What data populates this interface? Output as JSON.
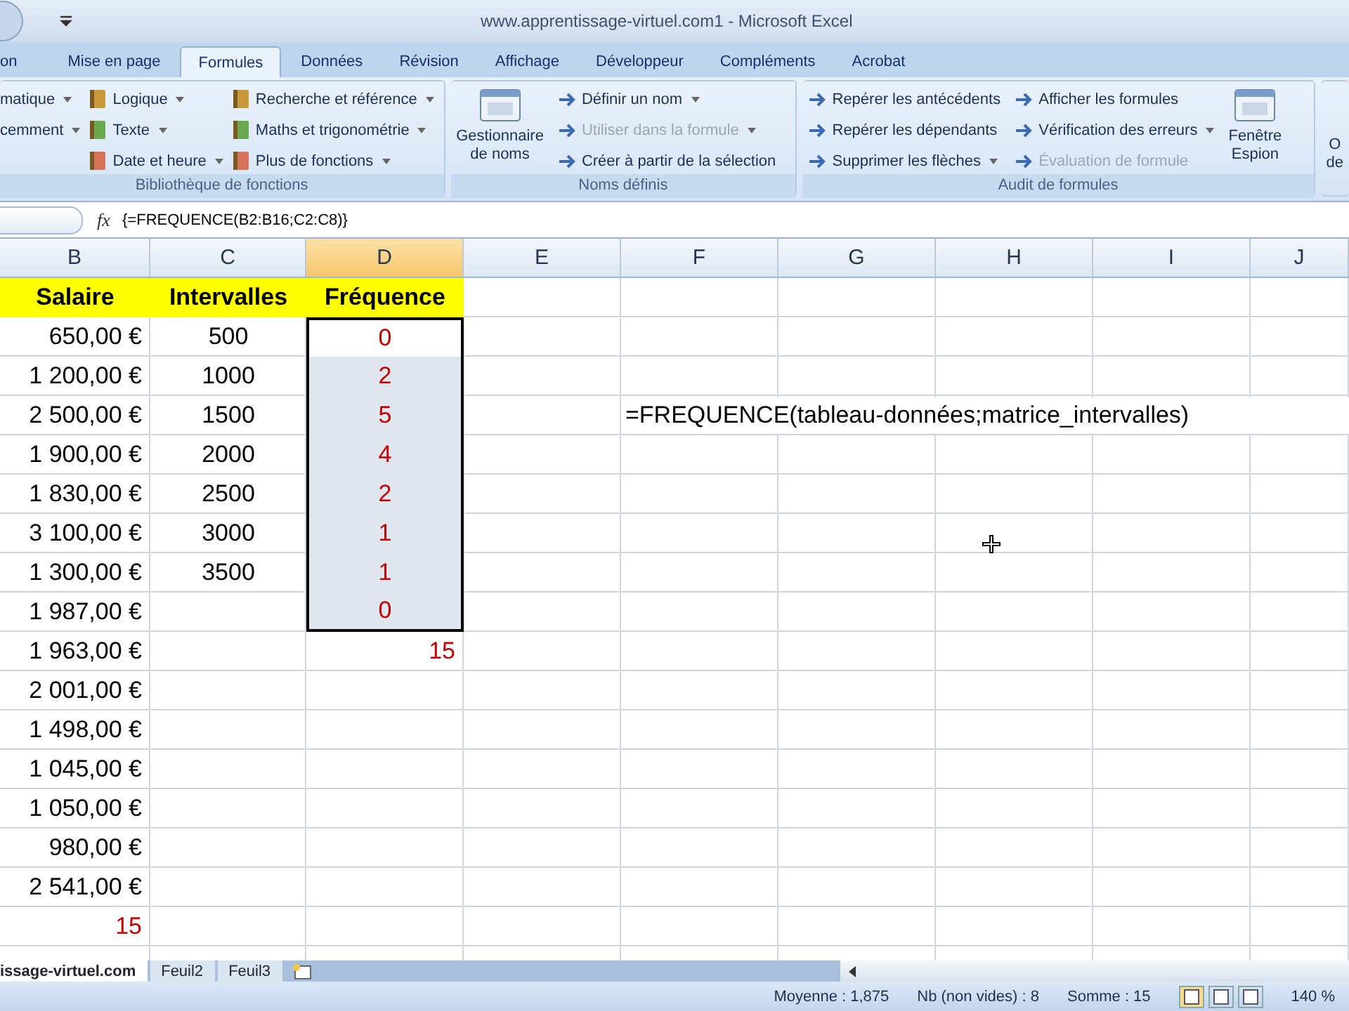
{
  "window": {
    "title": "www.apprentissage-virtuel.com1 - Microsoft Excel"
  },
  "ribbon": {
    "tabs": [
      {
        "label": "on",
        "selected": false
      },
      {
        "label": "Mise en page",
        "selected": false
      },
      {
        "label": "Formules",
        "selected": true
      },
      {
        "label": "Données",
        "selected": false
      },
      {
        "label": "Révision",
        "selected": false
      },
      {
        "label": "Affichage",
        "selected": false
      },
      {
        "label": "Développeur",
        "selected": false
      },
      {
        "label": "Compléments",
        "selected": false
      },
      {
        "label": "Acrobat",
        "selected": false
      }
    ],
    "groups": [
      {
        "label": "Bibliothèque de fonctions",
        "columns": [
          [
            {
              "kind": "bare",
              "label": "matique",
              "dropdown": true,
              "disabled": false
            },
            {
              "kind": "bare",
              "label": "cemment",
              "dropdown": true,
              "disabled": false
            }
          ],
          [
            {
              "kind": "small",
              "label": "Logique",
              "dropdown": true,
              "disabled": false
            },
            {
              "kind": "small",
              "label": "Texte",
              "dropdown": true,
              "disabled": false
            },
            {
              "kind": "small",
              "label": "Date et heure",
              "dropdown": true,
              "disabled": false
            }
          ],
          [
            {
              "kind": "small",
              "label": "Recherche et référence",
              "dropdown": true,
              "disabled": false
            },
            {
              "kind": "small",
              "label": "Maths et trigonométrie",
              "dropdown": true,
              "disabled": false
            },
            {
              "kind": "small",
              "label": "Plus de fonctions",
              "dropdown": true,
              "disabled": false
            }
          ]
        ]
      },
      {
        "label": "Noms définis",
        "columns": [
          [
            {
              "kind": "large",
              "lines": [
                "Gestionnaire",
                "de noms"
              ],
              "disabled": false
            }
          ],
          [
            {
              "kind": "small",
              "label": "Définir un nom",
              "dropdown": true,
              "disabled": false
            },
            {
              "kind": "small",
              "label": "Utiliser dans la formule",
              "dropdown": true,
              "disabled": true
            },
            {
              "kind": "small",
              "label": "Créer à partir de la sélection",
              "dropdown": false,
              "disabled": false
            }
          ]
        ]
      },
      {
        "label": "Audit de formules",
        "columns": [
          [
            {
              "kind": "small",
              "label": "Repérer les antécédents",
              "dropdown": false,
              "disabled": false
            },
            {
              "kind": "small",
              "label": "Repérer les dépendants",
              "dropdown": false,
              "disabled": false
            },
            {
              "kind": "small",
              "label": "Supprimer les flèches",
              "dropdown": true,
              "disabled": false
            }
          ],
          [
            {
              "kind": "small",
              "label": "Afficher les formules",
              "dropdown": false,
              "disabled": false
            },
            {
              "kind": "small",
              "label": "Vérification des erreurs",
              "dropdown": true,
              "disabled": false
            },
            {
              "kind": "small",
              "label": "Évaluation de formule",
              "dropdown": false,
              "disabled": true
            }
          ],
          [
            {
              "kind": "large",
              "lines": [
                "Fenêtre",
                "Espion"
              ],
              "disabled": false
            }
          ]
        ]
      },
      {
        "columns": [
          [
            {
              "kind": "bare_large",
              "lines": [
                "O",
                "de"
              ]
            }
          ]
        ]
      }
    ]
  },
  "formula_bar": {
    "function_button": "fx",
    "formula": "{=FREQUENCE(B2:B16;C2:C8)}"
  },
  "sheet": {
    "columns": [
      {
        "label": "B",
        "selected": false
      },
      {
        "label": "C",
        "selected": false
      },
      {
        "label": "D",
        "selected": true
      },
      {
        "label": "E",
        "selected": false
      },
      {
        "label": "F",
        "selected": false
      },
      {
        "label": "G",
        "selected": false
      },
      {
        "label": "H",
        "selected": false
      },
      {
        "label": "I",
        "selected": false
      },
      {
        "label": "J",
        "selected": false
      }
    ],
    "rows": [
      {
        "cells": [
          {
            "kind": "header",
            "text": "Salaire",
            "selected": false
          },
          {
            "kind": "header",
            "text": "Intervalles",
            "selected": false
          },
          {
            "kind": "header",
            "text": "Fréquence",
            "selected": false
          }
        ]
      },
      {
        "cells": [
          {
            "kind": "amount",
            "text": "650,00 €",
            "selected": false
          },
          {
            "kind": "interval",
            "text": "500",
            "selected": false
          },
          {
            "kind": "frequency",
            "text": "0",
            "selected": true,
            "active": true,
            "color": "#c00000"
          }
        ]
      },
      {
        "cells": [
          {
            "kind": "amount",
            "text": "1 200,00 €",
            "selected": false
          },
          {
            "kind": "interval",
            "text": "1000",
            "selected": false
          },
          {
            "kind": "frequency",
            "text": "2",
            "selected": true,
            "active": false,
            "color": "#c00000"
          }
        ]
      },
      {
        "cells": [
          {
            "kind": "amount",
            "text": "2 500,00 €",
            "selected": false
          },
          {
            "kind": "interval",
            "text": "1500",
            "selected": false
          },
          {
            "kind": "frequency",
            "text": "5",
            "selected": true,
            "active": false,
            "color": "#c00000"
          },
          "",
          {
            "kind": "formula",
            "text": "=FREQUENCE(tableau-données;matrice_intervalles)",
            "selected": false
          }
        ]
      },
      {
        "cells": [
          {
            "kind": "amount",
            "text": "1 900,00 €",
            "selected": false
          },
          {
            "kind": "interval",
            "text": "2000",
            "selected": false
          },
          {
            "kind": "frequency",
            "text": "4",
            "selected": true,
            "active": false,
            "color": "#c00000"
          }
        ]
      },
      {
        "cells": [
          {
            "kind": "amount",
            "text": "1 830,00 €",
            "selected": false
          },
          {
            "kind": "interval",
            "text": "2500",
            "selected": false
          },
          {
            "kind": "frequency",
            "text": "2",
            "selected": true,
            "active": false,
            "color": "#c00000"
          }
        ]
      },
      {
        "cells": [
          {
            "kind": "amount",
            "text": "3 100,00 €",
            "selected": false
          },
          {
            "kind": "interval",
            "text": "3000",
            "selected": false
          },
          {
            "kind": "frequency",
            "text": "1",
            "selected": true,
            "active": false,
            "color": "#c00000"
          }
        ]
      },
      {
        "cells": [
          {
            "kind": "amount",
            "text": "1 300,00 €",
            "selected": false
          },
          {
            "kind": "interval",
            "text": "3500",
            "selected": false
          },
          {
            "kind": "frequency",
            "text": "1",
            "selected": true,
            "active": false,
            "color": "#c00000"
          }
        ]
      },
      {
        "cells": [
          {
            "kind": "amount",
            "text": "1 987,00 €",
            "selected": false
          },
          "",
          {
            "kind": "frequency",
            "text": "0",
            "selected": true,
            "active": false,
            "color": "#c00000"
          }
        ]
      },
      {
        "cells": [
          {
            "kind": "amount",
            "text": "1 963,00 €",
            "selected": false
          },
          "",
          {
            "kind": "total",
            "text": "15",
            "selected": false,
            "color": "#c00000"
          }
        ]
      },
      {
        "cells": [
          {
            "kind": "amount",
            "text": "2 001,00 €",
            "selected": false
          }
        ]
      },
      {
        "cells": [
          {
            "kind": "amount",
            "text": "1 498,00 €",
            "selected": false
          }
        ]
      },
      {
        "cells": [
          {
            "kind": "amount",
            "text": "1 045,00 €",
            "selected": false
          }
        ]
      },
      {
        "cells": [
          {
            "kind": "amount",
            "text": "1 050,00 €",
            "selected": false
          }
        ]
      },
      {
        "cells": [
          {
            "kind": "amount",
            "text": "980,00 €",
            "selected": false
          }
        ]
      },
      {
        "cells": [
          {
            "kind": "amount",
            "text": "2 541,00 €",
            "selected": false
          }
        ]
      },
      {
        "cells": [
          {
            "kind": "total",
            "text": "15",
            "selected": false,
            "color": "#c00000"
          }
        ]
      }
    ]
  },
  "sheet_tabs": [
    {
      "label": "issage-virtuel.com",
      "selected": true
    },
    {
      "label": "Feuil2",
      "selected": false
    },
    {
      "label": "Feuil3",
      "selected": false
    }
  ],
  "status_bar": {
    "stats": [
      "Moyenne : 1,875",
      "Nb (non vides) : 8",
      "Somme : 15"
    ],
    "views": [
      {
        "selected": true
      },
      {
        "selected": false
      },
      {
        "selected": false
      }
    ],
    "zoom": "140 %"
  }
}
